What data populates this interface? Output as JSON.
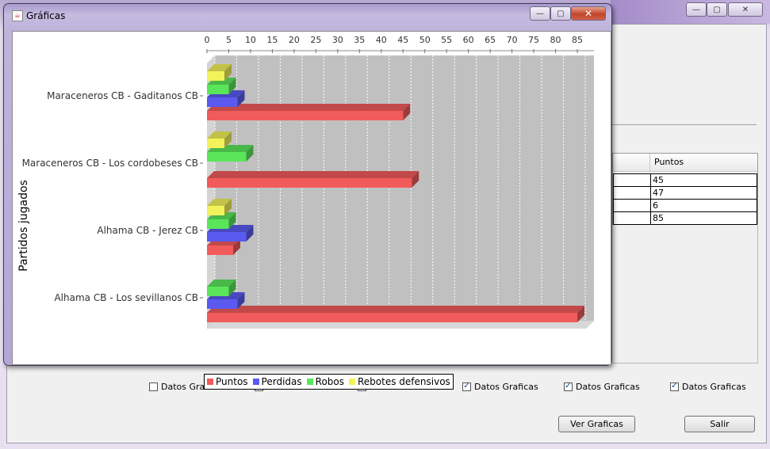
{
  "front_window": {
    "title": "Gráficas",
    "minimize": "—",
    "maximize": "▢",
    "close": "✕"
  },
  "back_window": {
    "minimize": "—",
    "maximize": "▢",
    "close": "✕"
  },
  "table": {
    "header": "Puntos",
    "rows": [
      "45",
      "47",
      "6",
      "85"
    ]
  },
  "checkboxes": [
    {
      "label": "Datos Graficas",
      "checked": false
    },
    {
      "label": "Datos Graficas",
      "checked": false
    },
    {
      "label": "Datos Graficas",
      "checked": true
    },
    {
      "label": "Datos Graficas",
      "checked": true
    },
    {
      "label": "Datos Graficas",
      "checked": true
    },
    {
      "label": "Datos Graficas",
      "checked": true
    }
  ],
  "buttons": {
    "ver_graficas": "Ver Graficas",
    "salir": "Salir"
  },
  "chart_data": {
    "type": "bar",
    "orientation": "horizontal",
    "ylabel": "Partidos jugados",
    "xlim": [
      0,
      90
    ],
    "xticks": [
      "0",
      "5",
      "10",
      "15",
      "20",
      "25",
      "30",
      "35",
      "40",
      "45",
      "50",
      "55",
      "60",
      "65",
      "70",
      "75",
      "80",
      "85"
    ],
    "categories": [
      "Maraceneros CB - Gaditanos CB",
      "Maraceneros CB - Los cordobeses CB",
      "Alhama CB - Jerez CB",
      "Alhama CB - Los sevillanos CB"
    ],
    "series": [
      {
        "name": "Puntos",
        "color": "#f25b5b",
        "values": [
          45,
          47,
          6,
          85
        ]
      },
      {
        "name": "Perdidas",
        "color": "#5a5af0",
        "values": [
          7,
          0,
          9,
          7
        ]
      },
      {
        "name": "Robos",
        "color": "#5ae65a",
        "values": [
          5,
          9,
          5,
          5
        ]
      },
      {
        "name": "Rebotes defensivos",
        "color": "#f2f25a",
        "values": [
          4,
          4,
          4,
          0
        ]
      }
    ],
    "legend": "bottom",
    "grid": true
  }
}
